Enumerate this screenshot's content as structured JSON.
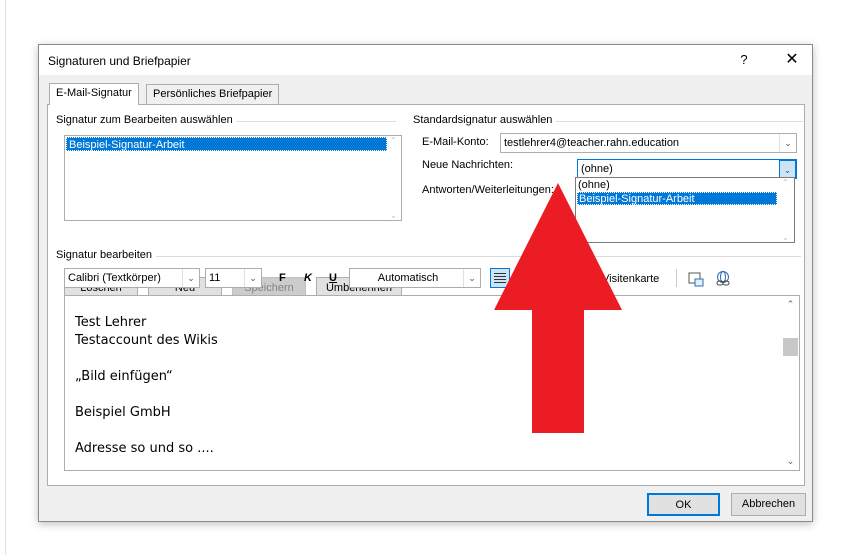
{
  "dialog": {
    "title": "Signaturen und Briefpapier",
    "help": "?",
    "close": "✕"
  },
  "tabs": [
    {
      "label": "E-Mail-Signatur",
      "active": true
    },
    {
      "label": "Persönliches Briefpapier",
      "active": false
    }
  ],
  "edit_section": {
    "heading": "Signatur zum Bearbeiten auswählen",
    "items": [
      "Beispiel-Signatur-Arbeit"
    ],
    "buttons": {
      "delete": "Löschen",
      "new": "Neu",
      "save": "Speichern",
      "rename": "Umbenennen"
    }
  },
  "default_section": {
    "heading": "Standardsignatur auswählen",
    "account_label": "E-Mail-Konto:",
    "account_value": "testlehrer4@teacher.rahn.education",
    "new_messages_label": "Neue Nachrichten:",
    "new_messages_value": "(ohne)",
    "replies_label": "Antworten/Weiterleitungen:",
    "dropdown_options": [
      "(ohne)",
      "Beispiel-Signatur-Arbeit"
    ]
  },
  "signature_editor": {
    "heading": "Signatur bearbeiten",
    "font": "Calibri (Textkörper)",
    "size": "11",
    "bold": "F",
    "italic": "K",
    "underline": "U",
    "color": "Automatisch",
    "business_card": "Visitenkarte",
    "lines": [
      "Test Lehrer",
      "Testaccount des Wikis",
      "„Bild einfügen“",
      "Beispiel GmbH",
      "Adresse so und so ...."
    ]
  },
  "footer": {
    "ok": "OK",
    "cancel": "Abbrechen"
  },
  "colors": {
    "selection": "#0078d7",
    "annotation_arrow": "#ec1c24"
  }
}
